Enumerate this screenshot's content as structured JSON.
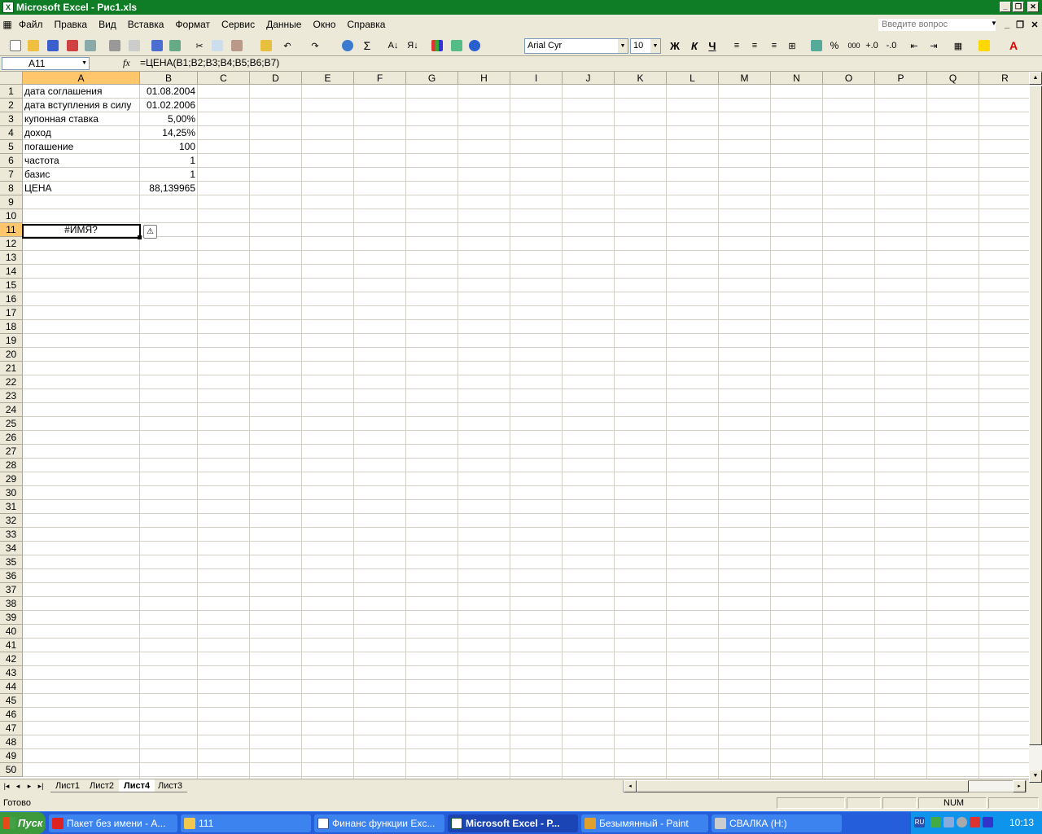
{
  "window": {
    "title": "Microsoft Excel - Рис1.xls"
  },
  "menu": [
    "Файл",
    "Правка",
    "Вид",
    "Вставка",
    "Формат",
    "Сервис",
    "Данные",
    "Окно",
    "Справка"
  ],
  "help_placeholder": "Введите вопрос",
  "format": {
    "font": "Arial Cyr",
    "size": "10",
    "bold": "Ж",
    "italic": "К",
    "underline": "Ч",
    "percent": "%",
    "thousands": "000"
  },
  "formula_bar": {
    "name_box": "A11",
    "fx": "fx",
    "formula": "=ЦЕНА(B1;B2;B3;B4;B5;B6;B7)"
  },
  "columns": [
    "A",
    "B",
    "C",
    "D",
    "E",
    "F",
    "G",
    "H",
    "I",
    "J",
    "K",
    "L",
    "M",
    "N",
    "O",
    "P",
    "Q",
    "R"
  ],
  "rows": [
    "1",
    "2",
    "3",
    "4",
    "5",
    "6",
    "7",
    "8",
    "9",
    "10",
    "11",
    "12",
    "13",
    "14",
    "15",
    "16",
    "17",
    "18",
    "19",
    "20",
    "21",
    "22",
    "23",
    "24",
    "25",
    "26",
    "27",
    "28",
    "29",
    "30",
    "31",
    "32",
    "33",
    "34",
    "35",
    "36",
    "37",
    "38",
    "39",
    "40",
    "41",
    "42",
    "43",
    "44",
    "45",
    "46",
    "47",
    "48",
    "49",
    "50"
  ],
  "cells": {
    "A1": "дата соглашения",
    "B1": "01.08.2004",
    "A2": "дата вступления в силу",
    "B2": "01.02.2006",
    "A3": "купонная ставка",
    "B3": "5,00%",
    "A4": "доход",
    "B4": "14,25%",
    "A5": "погашение",
    "B5": "100",
    "A6": "частота",
    "B6": "1",
    "A7": "базис",
    "B7": "1",
    "A8": "ЦЕНА",
    "B8": "88,139965",
    "A11": "#ИМЯ?"
  },
  "sheets": [
    "Лист1",
    "Лист2",
    "Лист4",
    "Лист3"
  ],
  "active_sheet": "Лист4",
  "status": {
    "text": "Готово",
    "num": "NUM"
  },
  "taskbar": {
    "start": "Пуск",
    "items": [
      "Пакет без имени - А...",
      "111",
      "Финанс функции Exc...",
      "Microsoft Excel - Р...",
      "Безымянный - Paint",
      "СВАЛКА (H:)"
    ],
    "clock": "10:13"
  }
}
